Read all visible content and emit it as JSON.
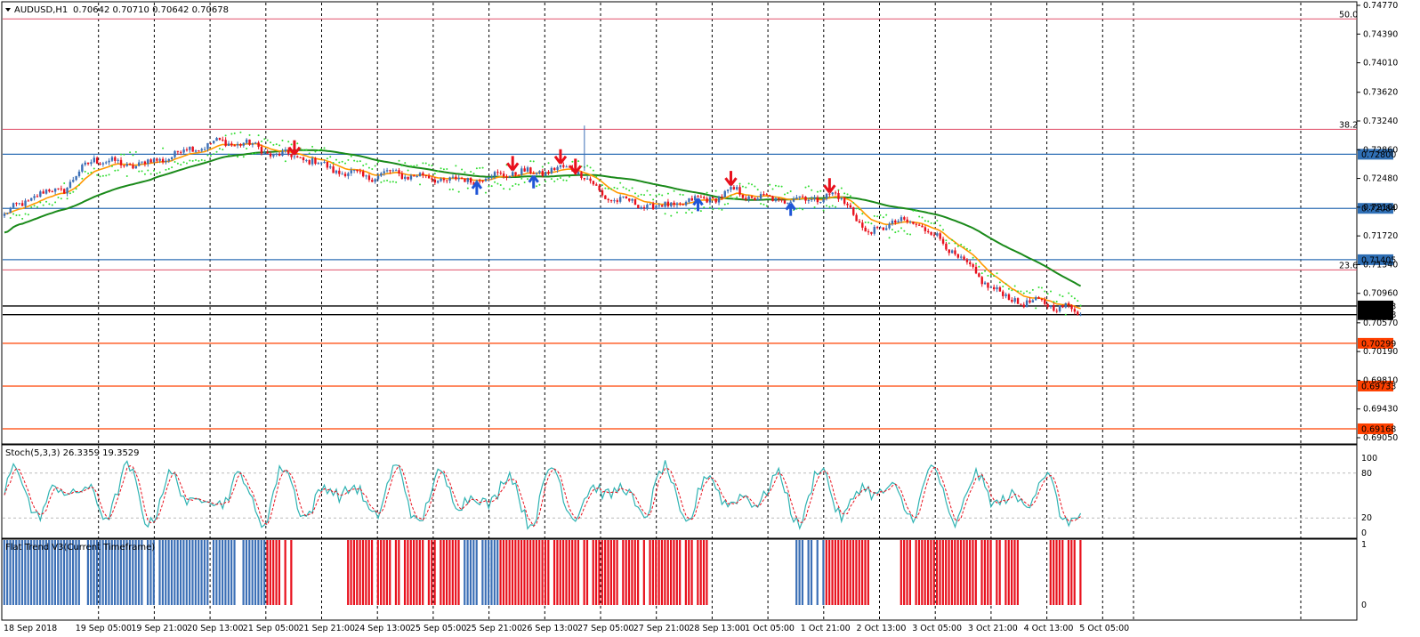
{
  "header": {
    "symbol": "AUDUSD,H1",
    "ohlc": "0.70642 0.70710 0.70642 0.70678"
  },
  "stoch_header": "Stoch(5,3,3) 26.3359 19.3529",
  "flat_header": "Flat Trend V3(Current Timeframe)",
  "chart_data": {
    "type": "candlestick",
    "price_range": [
      0.6905,
      0.7477
    ],
    "price_ticks": [
      "0.74770",
      "0.74390",
      "0.74010",
      "0.73620",
      "0.73240",
      "0.72860",
      "0.72480",
      "0.72100",
      "0.71720",
      "0.71340",
      "0.70960",
      "0.70570",
      "0.70190",
      "0.69810",
      "0.69430",
      "0.69050"
    ],
    "x_labels": [
      "18 Sep 2018",
      "19 Sep 05:00",
      "19 Sep 21:00",
      "20 Sep 13:00",
      "21 Sep 05:00",
      "21 Sep 21:00",
      "24 Sep 13:00",
      "25 Sep 05:00",
      "25 Sep 21:00",
      "26 Sep 13:00",
      "27 Sep 05:00",
      "27 Sep 21:00",
      "28 Sep 13:00",
      "1 Oct 05:00",
      "1 Oct 21:00",
      "2 Oct 13:00",
      "3 Oct 05:00",
      "3 Oct 21:00",
      "4 Oct 13:00",
      "5 Oct 05:00"
    ],
    "fib_levels": [
      {
        "label": "50.0",
        "price": 0.7459
      },
      {
        "label": "38.2",
        "price": 0.7313
      },
      {
        "label": "23.6",
        "price": 0.7127
      }
    ],
    "horizontal_lines": [
      {
        "label": "0.72800",
        "price": 0.728,
        "color": "#2f6fb5",
        "kind": "blue"
      },
      {
        "label": "0.72084",
        "price": 0.72084,
        "color": "#2f6fb5",
        "kind": "blue"
      },
      {
        "label": "0.71405",
        "price": 0.71405,
        "color": "#2f6fb5",
        "kind": "blue"
      },
      {
        "label": "0.70793",
        "price": 0.70793,
        "color": "#000000",
        "kind": "black"
      },
      {
        "label": "0.70678",
        "price": 0.70678,
        "color": "#000000",
        "kind": "black"
      },
      {
        "label": "0.70299",
        "price": 0.70299,
        "color": "#ff4000",
        "kind": "orange"
      },
      {
        "label": "0.69733",
        "price": 0.69733,
        "color": "#ff4000",
        "kind": "orange"
      },
      {
        "label": "0.69168",
        "price": 0.69168,
        "color": "#ff4000",
        "kind": "orange"
      }
    ],
    "close_keypoints": [
      [
        0,
        0.72
      ],
      [
        10,
        0.7225
      ],
      [
        20,
        0.7235
      ],
      [
        30,
        0.7275
      ],
      [
        40,
        0.7265
      ],
      [
        50,
        0.727
      ],
      [
        60,
        0.7285
      ],
      [
        70,
        0.7295
      ],
      [
        80,
        0.7295
      ],
      [
        90,
        0.728
      ],
      [
        100,
        0.7275
      ],
      [
        110,
        0.726
      ],
      [
        120,
        0.725
      ],
      [
        130,
        0.7255
      ],
      [
        140,
        0.725
      ],
      [
        150,
        0.7245
      ],
      [
        160,
        0.7248
      ],
      [
        168,
        0.7255
      ],
      [
        175,
        0.7255
      ],
      [
        182,
        0.7258
      ],
      [
        190,
        0.7262
      ],
      [
        193,
        0.7255
      ],
      [
        200,
        0.7225
      ],
      [
        210,
        0.7215
      ],
      [
        220,
        0.721
      ],
      [
        230,
        0.7218
      ],
      [
        240,
        0.7225
      ],
      [
        245,
        0.7232
      ],
      [
        250,
        0.7222
      ],
      [
        260,
        0.722
      ],
      [
        270,
        0.7222
      ],
      [
        278,
        0.7225
      ],
      [
        283,
        0.7212
      ],
      [
        288,
        0.7172
      ],
      [
        295,
        0.7188
      ],
      [
        305,
        0.719
      ],
      [
        315,
        0.716
      ],
      [
        325,
        0.712
      ],
      [
        335,
        0.709
      ],
      [
        340,
        0.7085
      ],
      [
        348,
        0.7082
      ],
      [
        355,
        0.7078
      ],
      [
        360,
        0.70678
      ]
    ],
    "ma_fast_color": "#ff9900",
    "ma_slow_color": "#1a8a1a",
    "psar_color": "#33dd33",
    "bull_color": "#3b6fb6",
    "bear_color": "#e8101c",
    "signal_arrows": [
      {
        "bar": 97,
        "dir": "down"
      },
      {
        "bar": 158,
        "dir": "up"
      },
      {
        "bar": 170,
        "dir": "down"
      },
      {
        "bar": 177,
        "dir": "up"
      },
      {
        "bar": 186,
        "dir": "down"
      },
      {
        "bar": 191,
        "dir": "down"
      },
      {
        "bar": 232,
        "dir": "up"
      },
      {
        "bar": 243,
        "dir": "down"
      },
      {
        "bar": 263,
        "dir": "up"
      },
      {
        "bar": 276,
        "dir": "down"
      }
    ],
    "stoch": {
      "levels": [
        "100",
        "80",
        "20",
        "0"
      ],
      "k_color": "#2fb3b3",
      "d_color": "#e8101c"
    },
    "flat_trend": {
      "axis": [
        "1",
        "0"
      ],
      "blocks": [
        {
          "from": 0,
          "to": 88,
          "color": "blue"
        },
        {
          "from": 88,
          "to": 97,
          "color": "red"
        },
        {
          "from": 97,
          "to": 115,
          "color": "white"
        },
        {
          "from": 115,
          "to": 153,
          "color": "red"
        },
        {
          "from": 153,
          "to": 166,
          "color": "blue"
        },
        {
          "from": 166,
          "to": 180,
          "color": "red"
        },
        {
          "from": 180,
          "to": 238,
          "color": "red"
        },
        {
          "from": 238,
          "to": 265,
          "color": "white"
        },
        {
          "from": 265,
          "to": 275,
          "color": "blue"
        },
        {
          "from": 275,
          "to": 290,
          "color": "red"
        },
        {
          "from": 290,
          "to": 300,
          "color": "white"
        },
        {
          "from": 300,
          "to": 340,
          "color": "red"
        },
        {
          "from": 340,
          "to": 349,
          "color": "white"
        },
        {
          "from": 349,
          "to": 361,
          "color": "red"
        }
      ]
    }
  }
}
